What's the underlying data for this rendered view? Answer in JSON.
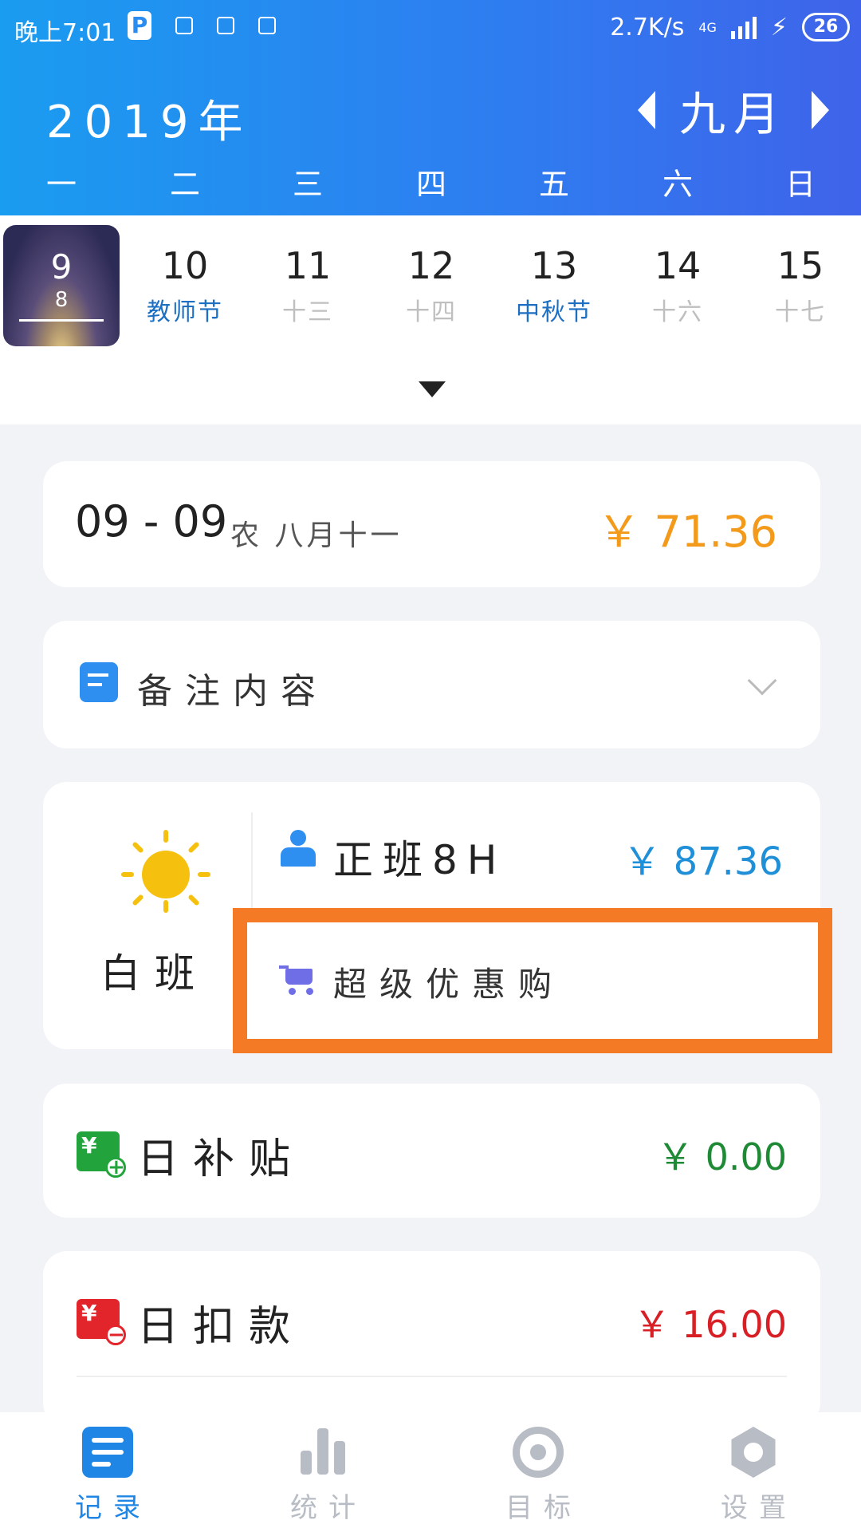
{
  "status_bar": {
    "time": "晚上7:01",
    "speed": "2.7K/s",
    "network": "4G",
    "battery": "26"
  },
  "calendar": {
    "year": "2019年",
    "month": "九月",
    "weekdays": [
      "一",
      "二",
      "三",
      "四",
      "五",
      "六",
      "日"
    ],
    "today": {
      "day": "9",
      "sub": "8"
    },
    "days": [
      {
        "n": "10",
        "l": "教师节"
      },
      {
        "n": "11",
        "l": "十三"
      },
      {
        "n": "12",
        "l": "十四"
      },
      {
        "n": "13",
        "l": "中秋节"
      },
      {
        "n": "14",
        "l": "十六"
      },
      {
        "n": "15",
        "l": "十七"
      }
    ]
  },
  "summary": {
    "date": "09 - 09",
    "lunar": "农 八月十一",
    "amount": "￥ 71.36"
  },
  "note": {
    "label": "备注内容"
  },
  "shift": {
    "name": "白班",
    "type": "正班8H",
    "amount": "￥ 87.36",
    "promo": "超级优惠购"
  },
  "subsidy": {
    "label": "日补贴",
    "amount": "￥ 0.00",
    "icon_text": "¥"
  },
  "deduction": {
    "label": "日扣款",
    "amount": "￥ 16.00",
    "icon_text": "¥"
  },
  "tabs": [
    {
      "label": "记录",
      "icon": "list-icon"
    },
    {
      "label": "统计",
      "icon": "bar-chart-icon"
    },
    {
      "label": "目标",
      "icon": "target-icon"
    },
    {
      "label": "设置",
      "icon": "gear-icon"
    }
  ],
  "colors": {
    "accent": "#1f86e6",
    "summary_amount": "#f39a1b",
    "shift_amount": "#1f8fd8",
    "subsidy": "#1e8a35",
    "deduction": "#d91f26",
    "promo_border": "#f47a25"
  }
}
